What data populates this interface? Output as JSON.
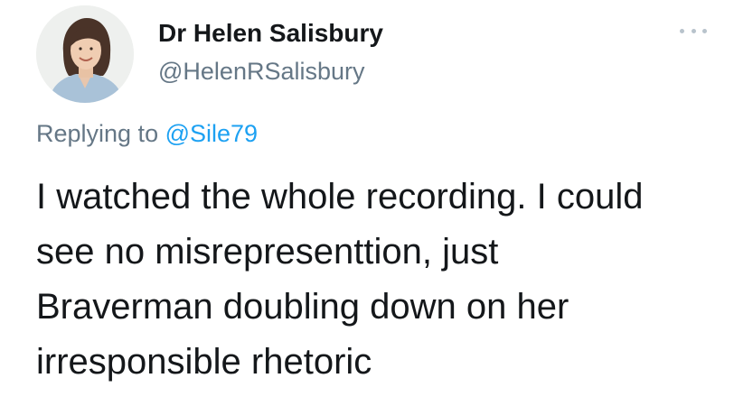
{
  "author": {
    "display_name": "Dr Helen Salisbury",
    "handle": "@HelenRSalisbury",
    "avatar_icon": "profile-photo"
  },
  "more_menu": {
    "icon": "more-horizontal-icon"
  },
  "reply_context": {
    "prefix": "Replying to",
    "mention": "@Sile79"
  },
  "tweet": {
    "lines": [
      "I watched the whole recording. I could",
      "see no misrepresenttion, just",
      "Braverman doubling down on her",
      "irresponsible rhetoric"
    ]
  },
  "colors": {
    "text_primary": "#14171a",
    "text_secondary": "#657786",
    "link": "#1da1f2"
  }
}
